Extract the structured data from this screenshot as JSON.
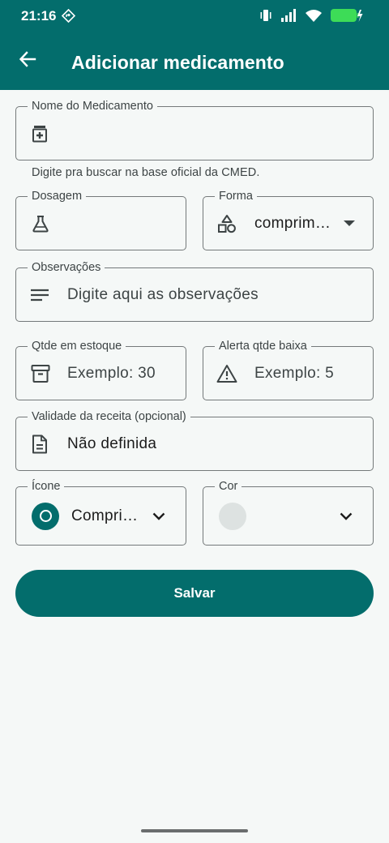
{
  "status_bar": {
    "time": "21:16",
    "icons": [
      "navigation-diamond-icon",
      "vibrate-icon",
      "signal-icon",
      "wifi-icon",
      "battery-charging-icon"
    ]
  },
  "app_bar": {
    "title": "Adicionar medicamento",
    "back_icon": "arrow-back-icon"
  },
  "form": {
    "medication_name": {
      "label": "Nome do Medicamento",
      "value": "",
      "icon": "medication-icon"
    },
    "medication_helper": "Digite pra buscar na base oficial da CMED.",
    "dosage": {
      "label": "Dosagem",
      "value": "",
      "icon": "flask-icon"
    },
    "form_type": {
      "label": "Forma",
      "value": "comprim…",
      "icon": "shapes-icon"
    },
    "notes": {
      "label": "Observações",
      "placeholder": "Digite aqui as observações",
      "icon": "notes-icon"
    },
    "stock_qty": {
      "label": "Qtde em estoque",
      "placeholder": "Exemplo: 30",
      "icon": "archive-icon"
    },
    "low_stock_alert": {
      "label": "Alerta qtde baixa",
      "placeholder": "Exemplo: 5",
      "icon": "warning-icon"
    },
    "prescription_validity": {
      "label": "Validade da receita (opcional)",
      "value": "Não definida",
      "icon": "document-icon"
    },
    "icon_select": {
      "label": "Ícone",
      "value": "Compri…",
      "icon": "pill-circle-icon"
    },
    "color_select": {
      "label": "Cor",
      "value": "",
      "selected_color": "#dde2e1"
    }
  },
  "save_button": {
    "label": "Salvar"
  },
  "colors": {
    "primary": "#036d6c",
    "background": "#f5f8f7",
    "outline": "#74797a"
  }
}
